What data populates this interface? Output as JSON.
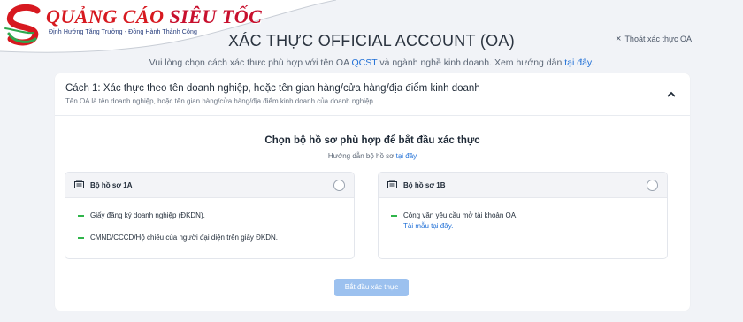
{
  "logo": {
    "title_part1": "QUẢNG CÁO",
    "title_part2": "SIÊU TỐC",
    "tagline": "Định Hướng Tăng Trưởng - Đồng Hành Thành Công"
  },
  "header": {
    "title": "XÁC THỰC OFFICIAL ACCOUNT (OA)",
    "exit_label": "Thoát xác thực OA",
    "subtitle_before": "Vui lòng chọn cách xác thực phù hợp với tên OA ",
    "oa_name": "QCST",
    "subtitle_after": " và ngành nghề kinh doanh. Xem hướng dẫn ",
    "subtitle_link": "tại đây",
    "subtitle_end": "."
  },
  "card": {
    "title": "Cách 1: Xác thực theo tên doanh nghiệp, hoặc tên gian hàng/cửa hàng/địa điểm kinh doanh",
    "description": "Tên OA là tên doanh nghiệp, hoặc tên gian hàng/cửa hàng/địa điểm kinh doanh của doanh nghiệp.",
    "choose_title": "Chọn bộ hồ sơ phù hợp để bắt đầu xác thực",
    "guide_text": "Hướng dẫn bộ hồ sơ ",
    "guide_link": "tại đây"
  },
  "options": [
    {
      "label": "Bộ hồ sơ 1A",
      "selected": false,
      "items": [
        "Giấy đăng ký doanh nghiệp (ĐKDN).",
        "CMND/CCCD/Hộ chiếu của người đại diện trên giấy ĐKDN."
      ]
    },
    {
      "label": "Bộ hồ sơ 1B",
      "selected": false,
      "items": [
        "Công văn yêu cầu mở tài khoản OA."
      ],
      "link": "Tải mẫu tại đây."
    }
  ],
  "start_button": "Bắt đầu xác thực",
  "colors": {
    "accent": "#1f6fd6",
    "bullet": "#2fb54a",
    "button_disabled": "#9cc1ef",
    "logo_red": "#d71920",
    "logo_green": "#2fa84f"
  }
}
